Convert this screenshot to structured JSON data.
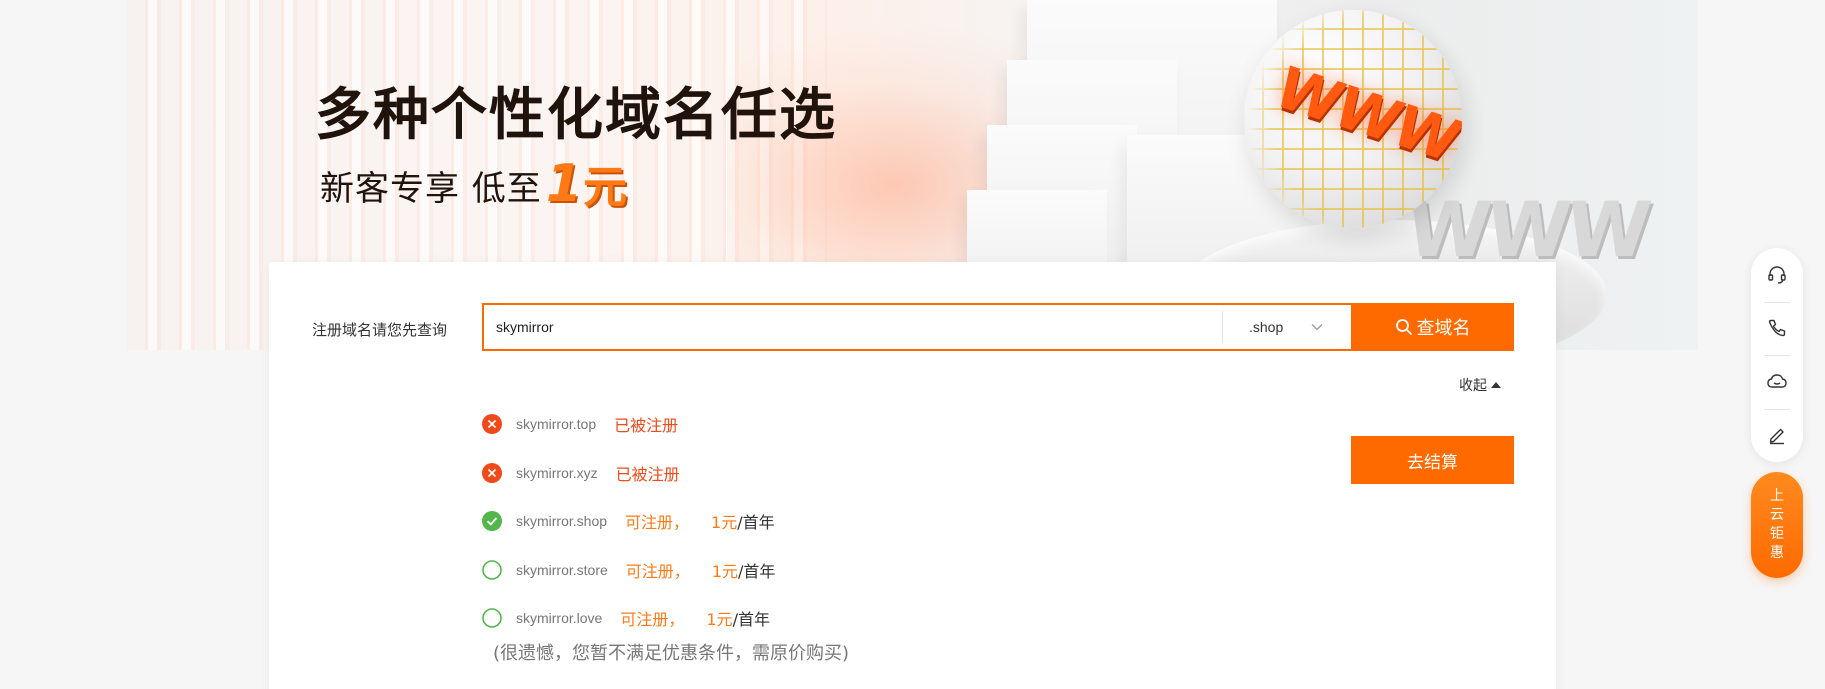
{
  "banner": {
    "headline": "多种个性化域名任选",
    "subline": "新客专享 低至",
    "price": "1",
    "unit": "元",
    "globe_text": "WWW",
    "shadow_text": "WWW"
  },
  "search": {
    "label": "注册域名请您先查询",
    "value": "skymirror",
    "suffix": ".shop",
    "button": "查域名",
    "collapse": "收起",
    "checkout": "去结算"
  },
  "results": [
    {
      "domain": "skymirror.top",
      "status": "已被注册",
      "state": "taken"
    },
    {
      "domain": "skymirror.xyz",
      "status": "已被注册",
      "state": "taken"
    },
    {
      "domain": "skymirror.shop",
      "status": "可注册，",
      "price": "1元",
      "per": "/首年",
      "state": "selected"
    },
    {
      "domain": "skymirror.store",
      "status": "可注册，",
      "price": "1元",
      "per": "/首年",
      "state": "available"
    },
    {
      "domain": "skymirror.love",
      "status": "可注册，",
      "price": "1元",
      "per": "/首年",
      "state": "available"
    }
  ],
  "notice": "(很遗憾，您暂不满足优惠条件，需原价购买)",
  "float_bar": {
    "items": [
      "headset-icon",
      "phone-icon",
      "chat-icon",
      "edit-icon"
    ],
    "promo": [
      "上",
      "云",
      "钜",
      "惠"
    ]
  },
  "colors": {
    "accent": "#ff6a00",
    "taken": "#f04a1a",
    "available": "#52b64a"
  }
}
